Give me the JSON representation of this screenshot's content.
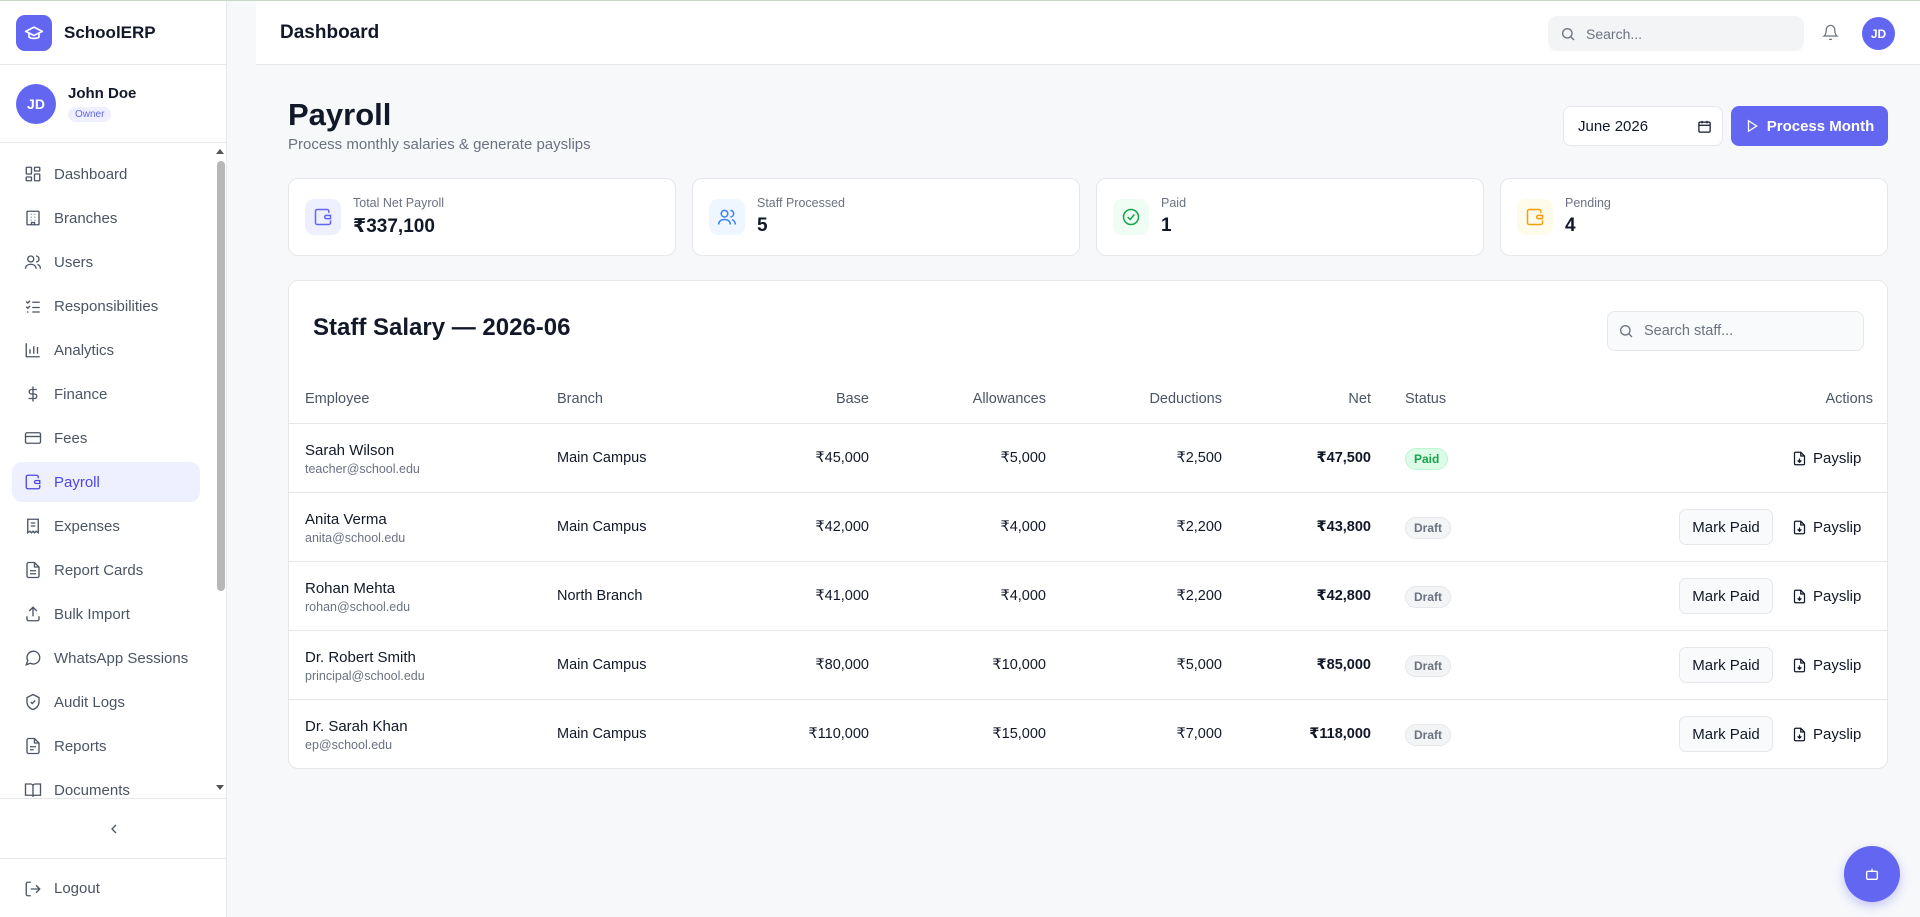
{
  "brand": {
    "name": "SchoolERP"
  },
  "user": {
    "name": "John Doe",
    "role": "Owner",
    "initials": "JD"
  },
  "sidebar": {
    "items": [
      {
        "label": "Dashboard",
        "icon": "dashboard-icon"
      },
      {
        "label": "Branches",
        "icon": "building-icon"
      },
      {
        "label": "Users",
        "icon": "users-icon"
      },
      {
        "label": "Responsibilities",
        "icon": "checklist-icon"
      },
      {
        "label": "Analytics",
        "icon": "bar-chart-icon"
      },
      {
        "label": "Finance",
        "icon": "dollar-icon"
      },
      {
        "label": "Fees",
        "icon": "credit-card-icon"
      },
      {
        "label": "Payroll",
        "icon": "wallet-icon",
        "active": true
      },
      {
        "label": "Expenses",
        "icon": "receipt-icon"
      },
      {
        "label": "Report Cards",
        "icon": "file-text-icon"
      },
      {
        "label": "Bulk Import",
        "icon": "upload-icon"
      },
      {
        "label": "WhatsApp Sessions",
        "icon": "message-icon"
      },
      {
        "label": "Audit Logs",
        "icon": "shield-icon"
      },
      {
        "label": "Reports",
        "icon": "file-icon"
      },
      {
        "label": "Documents",
        "icon": "book-icon"
      }
    ],
    "logout_label": "Logout"
  },
  "header": {
    "title": "Dashboard",
    "search_placeholder": "Search...",
    "avatar_initials": "JD"
  },
  "page": {
    "title": "Payroll",
    "subtitle": "Process monthly salaries & generate payslips",
    "month_value": "June 2026",
    "process_label": "Process Month"
  },
  "stats": [
    {
      "label": "Total Net Payroll",
      "value": "₹337,100",
      "icon": "wallet-icon",
      "color": "#6366f1"
    },
    {
      "label": "Staff Processed",
      "value": "5",
      "icon": "users-icon",
      "color": "#3b82f6"
    },
    {
      "label": "Paid",
      "value": "1",
      "icon": "check-circle-icon",
      "color": "#16a34a"
    },
    {
      "label": "Pending",
      "value": "4",
      "icon": "wallet-icon",
      "color": "#f59e0b"
    }
  ],
  "table": {
    "title": "Staff Salary — 2026-06",
    "search_placeholder": "Search staff...",
    "columns": [
      "Employee",
      "Branch",
      "Base",
      "Allowances",
      "Deductions",
      "Net",
      "Status",
      "Actions"
    ],
    "mark_paid_label": "Mark Paid",
    "payslip_label": "Payslip",
    "rows": [
      {
        "name": "Sarah Wilson",
        "email": "teacher@school.edu",
        "branch": "Main Campus",
        "base": "₹45,000",
        "allowances": "₹5,000",
        "deductions": "₹2,500",
        "net": "₹47,500",
        "status": "Paid"
      },
      {
        "name": "Anita Verma",
        "email": "anita@school.edu",
        "branch": "Main Campus",
        "base": "₹42,000",
        "allowances": "₹4,000",
        "deductions": "₹2,200",
        "net": "₹43,800",
        "status": "Draft"
      },
      {
        "name": "Rohan Mehta",
        "email": "rohan@school.edu",
        "branch": "North Branch",
        "base": "₹41,000",
        "allowances": "₹4,000",
        "deductions": "₹2,200",
        "net": "₹42,800",
        "status": "Draft"
      },
      {
        "name": "Dr. Robert Smith",
        "email": "principal@school.edu",
        "branch": "Main Campus",
        "base": "₹80,000",
        "allowances": "₹10,000",
        "deductions": "₹5,000",
        "net": "₹85,000",
        "status": "Draft"
      },
      {
        "name": "Dr. Sarah Khan",
        "email": "ep@school.edu",
        "branch": "Main Campus",
        "base": "₹110,000",
        "allowances": "₹15,000",
        "deductions": "₹7,000",
        "net": "₹118,000",
        "status": "Draft"
      }
    ]
  },
  "colors": {
    "accent": "#6366f1",
    "paid": "#16a34a",
    "draft": "#6b7280"
  }
}
